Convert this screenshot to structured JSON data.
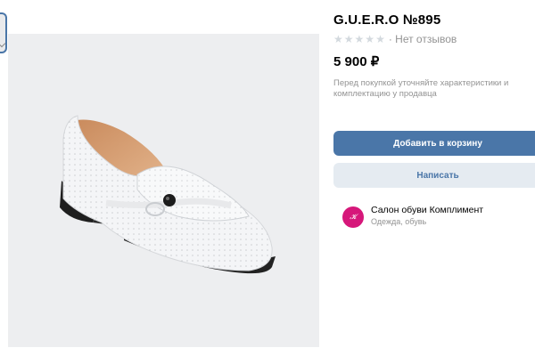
{
  "product": {
    "title": "G.U.E.R.O №895",
    "rating_stars": 5,
    "reviews_text": "· Нет отзывов",
    "price": "5 900 ₽",
    "note": "Перед покупкой уточняйте характеристики и комплектацию у продавца"
  },
  "actions": {
    "add_to_cart": "Добавить в корзину",
    "message": "Написать"
  },
  "seller": {
    "name": "Салон обуви Комплимент",
    "category": "Одежда, обувь"
  },
  "colors": {
    "accent": "#4a76a8",
    "secondary_bg": "#e5ebf1",
    "muted_text": "#939393",
    "avatar": "#d6177a"
  },
  "icons": [
    "star-icon",
    "chevron-down-icon",
    "seller-logo"
  ]
}
